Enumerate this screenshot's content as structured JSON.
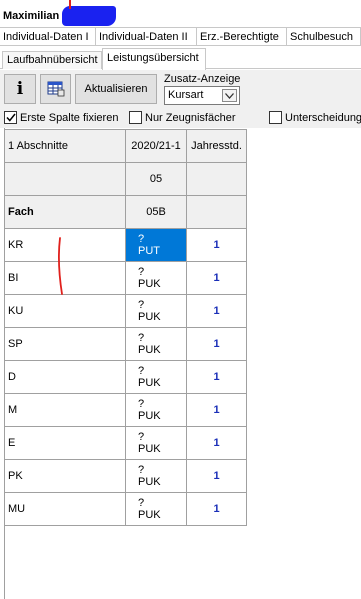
{
  "title": {
    "name": "Maximilian"
  },
  "tabs_primary": [
    "Individual-Daten I",
    "Individual-Daten II",
    "Erz.-Berechtigte",
    "Schulbesuch"
  ],
  "tabs_secondary": [
    "Laufbahnübersicht",
    "Leistungsübersicht"
  ],
  "toolbar": {
    "info_label": "i",
    "refresh_label": "Aktualisieren",
    "zusatz_label": "Zusatz-Anzeige",
    "zusatz_value": "Kursart"
  },
  "checkboxes": [
    {
      "label": "Erste Spalte fixieren",
      "checked": true
    },
    {
      "label": "Nur Zeugnisfächer",
      "checked": false
    },
    {
      "label": "Unterscheidung",
      "checked": false
    }
  ],
  "table": {
    "header": [
      "1 Abschnitte",
      "2020/21-1",
      "Jahresstd."
    ],
    "row_grade": [
      "",
      "05",
      ""
    ],
    "row_class": [
      "Fach",
      "05B",
      ""
    ],
    "rows": [
      {
        "subject": "KR",
        "grade": "?",
        "kursart": "PUT",
        "hours": "1"
      },
      {
        "subject": "BI",
        "grade": "?",
        "kursart": "PUK",
        "hours": "1"
      },
      {
        "subject": "KU",
        "grade": "?",
        "kursart": "PUK",
        "hours": "1"
      },
      {
        "subject": "SP",
        "grade": "?",
        "kursart": "PUK",
        "hours": "1"
      },
      {
        "subject": "D",
        "grade": "?",
        "kursart": "PUK",
        "hours": "1"
      },
      {
        "subject": "M",
        "grade": "?",
        "kursart": "PUK",
        "hours": "1"
      },
      {
        "subject": "E",
        "grade": "?",
        "kursart": "PUK",
        "hours": "1"
      },
      {
        "subject": "PK",
        "grade": "?",
        "kursart": "PUK",
        "hours": "1"
      },
      {
        "subject": "MU",
        "grade": "?",
        "kursart": "PUK",
        "hours": "1"
      }
    ]
  },
  "colors": {
    "selection": "#0078d7",
    "hours_text": "#1a2fb8",
    "redaction": "#1a22f0",
    "annotation": "#e0201c"
  }
}
